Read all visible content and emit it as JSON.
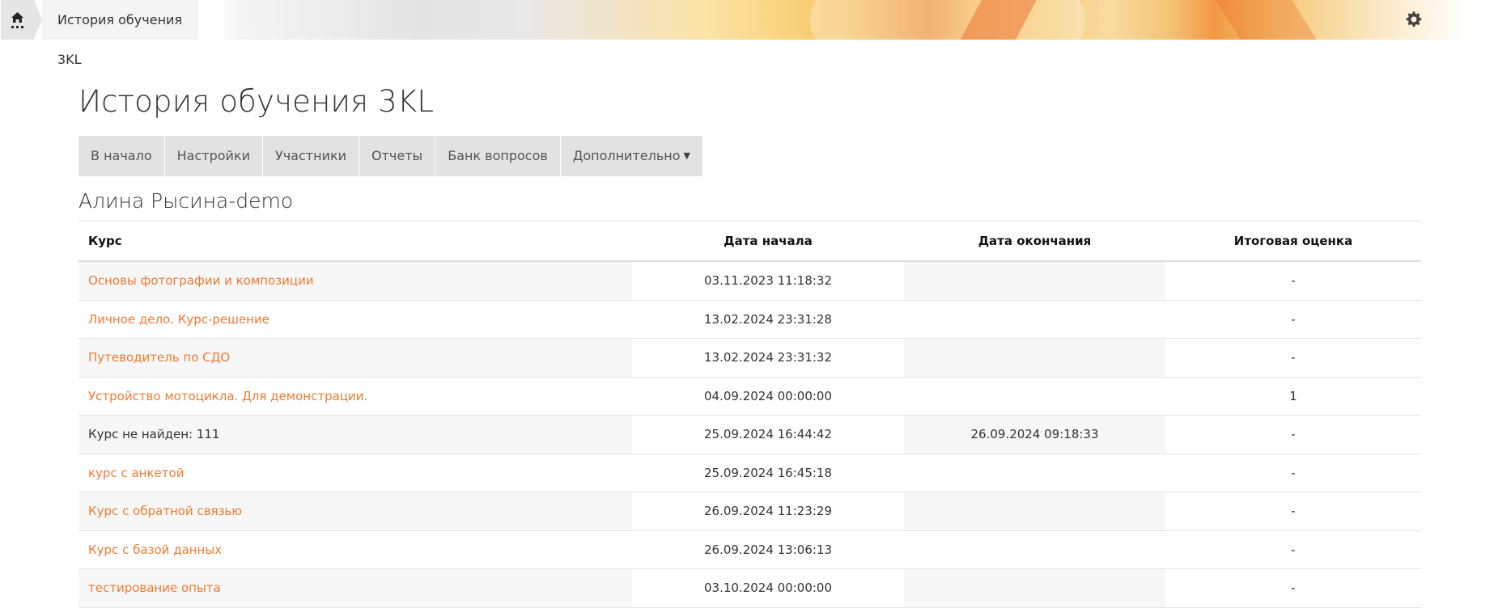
{
  "header": {
    "breadcrumb_current": "История обучения 3KL",
    "colors": {
      "accent": "#ef7b32",
      "tab_bg": "#e2e2e2"
    }
  },
  "page": {
    "title": "История обучения 3KL",
    "user_name": "Алина Рысина-demo"
  },
  "tabs": [
    {
      "label": "В начало"
    },
    {
      "label": "Настройки"
    },
    {
      "label": "Участники"
    },
    {
      "label": "Отчеты"
    },
    {
      "label": "Банк вопросов"
    },
    {
      "label": "Дополнительно"
    }
  ],
  "table": {
    "headers": [
      "Курс",
      "Дата начала",
      "Дата окончания",
      "Итоговая оценка"
    ],
    "rows": [
      {
        "course": "Основы фотографии и композиции",
        "start": "03.11.2023 11:18:32",
        "end": "",
        "grade": "-"
      },
      {
        "course": "Личное дело. Курс-решение",
        "start": "13.02.2024 23:31:28",
        "end": "",
        "grade": "-"
      },
      {
        "course": "Путеводитель по СДО",
        "start": "13.02.2024 23:31:32",
        "end": "",
        "grade": "-"
      },
      {
        "course": "Устройство мотоцикла. Для демонстрации.",
        "start": "04.09.2024 00:00:00",
        "end": "",
        "grade": "1"
      },
      {
        "course": "Курс не найден: 111",
        "start": "25.09.2024 16:44:42",
        "end": "26.09.2024 09:18:33",
        "grade": "-"
      },
      {
        "course": "курс с анкетой",
        "start": "25.09.2024 16:45:18",
        "end": "",
        "grade": "-"
      },
      {
        "course": "Курс с обратной связью",
        "start": "26.09.2024 11:23:29",
        "end": "",
        "grade": "-"
      },
      {
        "course": "Курс с базой данных",
        "start": "26.09.2024 13:06:13",
        "end": "",
        "grade": "-"
      },
      {
        "course": "тестирование опыта",
        "start": "03.10.2024 00:00:00",
        "end": "",
        "grade": "-"
      }
    ]
  }
}
